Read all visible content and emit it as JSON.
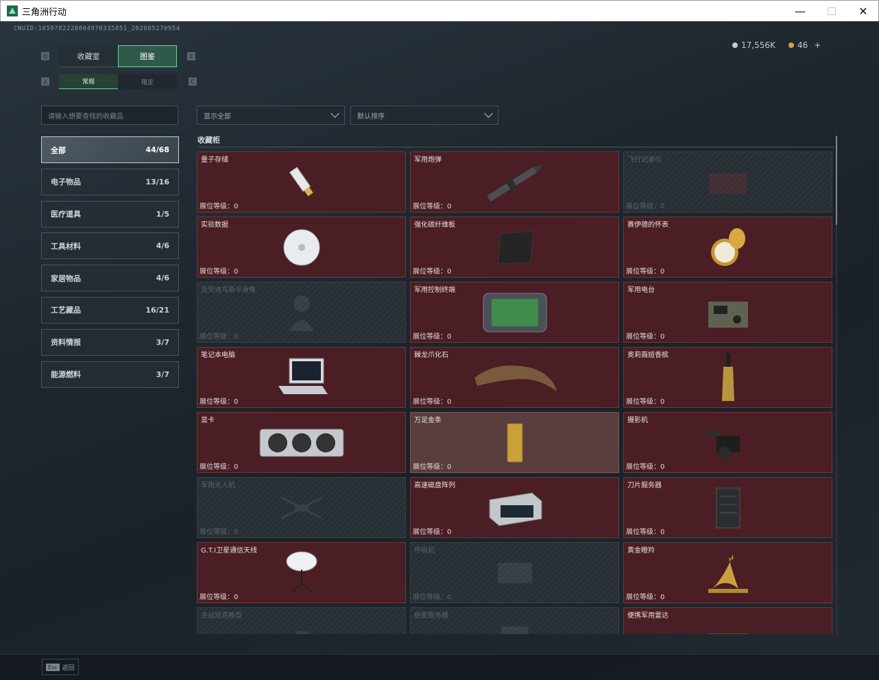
{
  "window": {
    "title": "三角洲行动",
    "min": "—",
    "max": "☐",
    "close": "✕"
  },
  "uid": "CNUID:1859782228804970335851_202605270954",
  "currency": {
    "silver": "17,556K",
    "gold": "46",
    "plus": "+"
  },
  "keys": {
    "left_tab": "Q",
    "right_tab": "E",
    "left_sub": "Z",
    "right_sub": "C"
  },
  "tabs": [
    {
      "label": "收藏室"
    },
    {
      "label": "图鉴"
    }
  ],
  "subtabs": [
    {
      "label": "常规"
    },
    {
      "label": "限定"
    }
  ],
  "search": {
    "placeholder": "请输入想要查找的收藏品"
  },
  "filters": {
    "display": "显示全部",
    "sort": "默认排序"
  },
  "categories": [
    {
      "label": "全部",
      "count": "44/68"
    },
    {
      "label": "电子物品",
      "count": "13/16"
    },
    {
      "label": "医疗道具",
      "count": "1/5"
    },
    {
      "label": "工具材料",
      "count": "4/6"
    },
    {
      "label": "家居物品",
      "count": "4/6"
    },
    {
      "label": "工艺藏品",
      "count": "16/21"
    },
    {
      "label": "资料情报",
      "count": "3/7"
    },
    {
      "label": "能源燃料",
      "count": "3/7"
    }
  ],
  "section_title": "收藏柜",
  "level_label": "展位等级：0",
  "items": [
    {
      "name": "量子存储",
      "icon": "usb-drive-icon",
      "state": "owned"
    },
    {
      "name": "军用炮弹",
      "icon": "shell-icon",
      "state": "owned"
    },
    {
      "name": "飞行记录仪",
      "icon": "flight-recorder-icon",
      "state": "locked"
    },
    {
      "name": "实验数据",
      "icon": "disc-icon",
      "state": "owned"
    },
    {
      "name": "强化碳纤维板",
      "icon": "carbon-plate-icon",
      "state": "owned"
    },
    {
      "name": "赛伊德的怀表",
      "icon": "pocket-watch-icon",
      "state": "owned"
    },
    {
      "name": "克劳迪乌斯半身像",
      "icon": "bust-icon",
      "state": "locked"
    },
    {
      "name": "军用控制终端",
      "icon": "terminal-icon",
      "state": "owned"
    },
    {
      "name": "军用电台",
      "icon": "radio-icon",
      "state": "owned"
    },
    {
      "name": "笔记本电脑",
      "icon": "laptop-icon",
      "state": "owned"
    },
    {
      "name": "棘龙爪化石",
      "icon": "claw-fossil-icon",
      "state": "owned"
    },
    {
      "name": "奥莉薇娅香槟",
      "icon": "champagne-icon",
      "state": "owned"
    },
    {
      "name": "显卡",
      "icon": "graphics-card-icon",
      "state": "owned"
    },
    {
      "name": "万足金条",
      "icon": "gold-bar-icon",
      "state": "gold"
    },
    {
      "name": "摄影机",
      "icon": "camera-icon",
      "state": "owned"
    },
    {
      "name": "军用无人机",
      "icon": "drone-icon",
      "state": "locked"
    },
    {
      "name": "高速磁盘阵列",
      "icon": "disk-array-icon",
      "state": "owned"
    },
    {
      "name": "刀片服务器",
      "icon": "blade-server-icon",
      "state": "owned"
    },
    {
      "name": "G.T.I卫星通信天线",
      "icon": "satellite-dish-icon",
      "state": "owned"
    },
    {
      "name": "呼吸机",
      "icon": "ventilator-icon",
      "state": "locked"
    },
    {
      "name": "黄金瞪羚",
      "icon": "gold-gazelle-icon",
      "state": "owned"
    },
    {
      "name": "主战坦克模型",
      "icon": "tank-model-icon",
      "state": "locked"
    },
    {
      "name": "绝密服务器",
      "icon": "server-icon",
      "state": "locked"
    },
    {
      "name": "便携军用雷达",
      "icon": "radar-icon",
      "state": "owned"
    }
  ],
  "footer": {
    "esc_key": "Esc",
    "esc_label": "返回"
  },
  "colors": {
    "accent": "#6fd3a4",
    "card_owned": "#4a1e24",
    "card_locked": "#262d33"
  }
}
